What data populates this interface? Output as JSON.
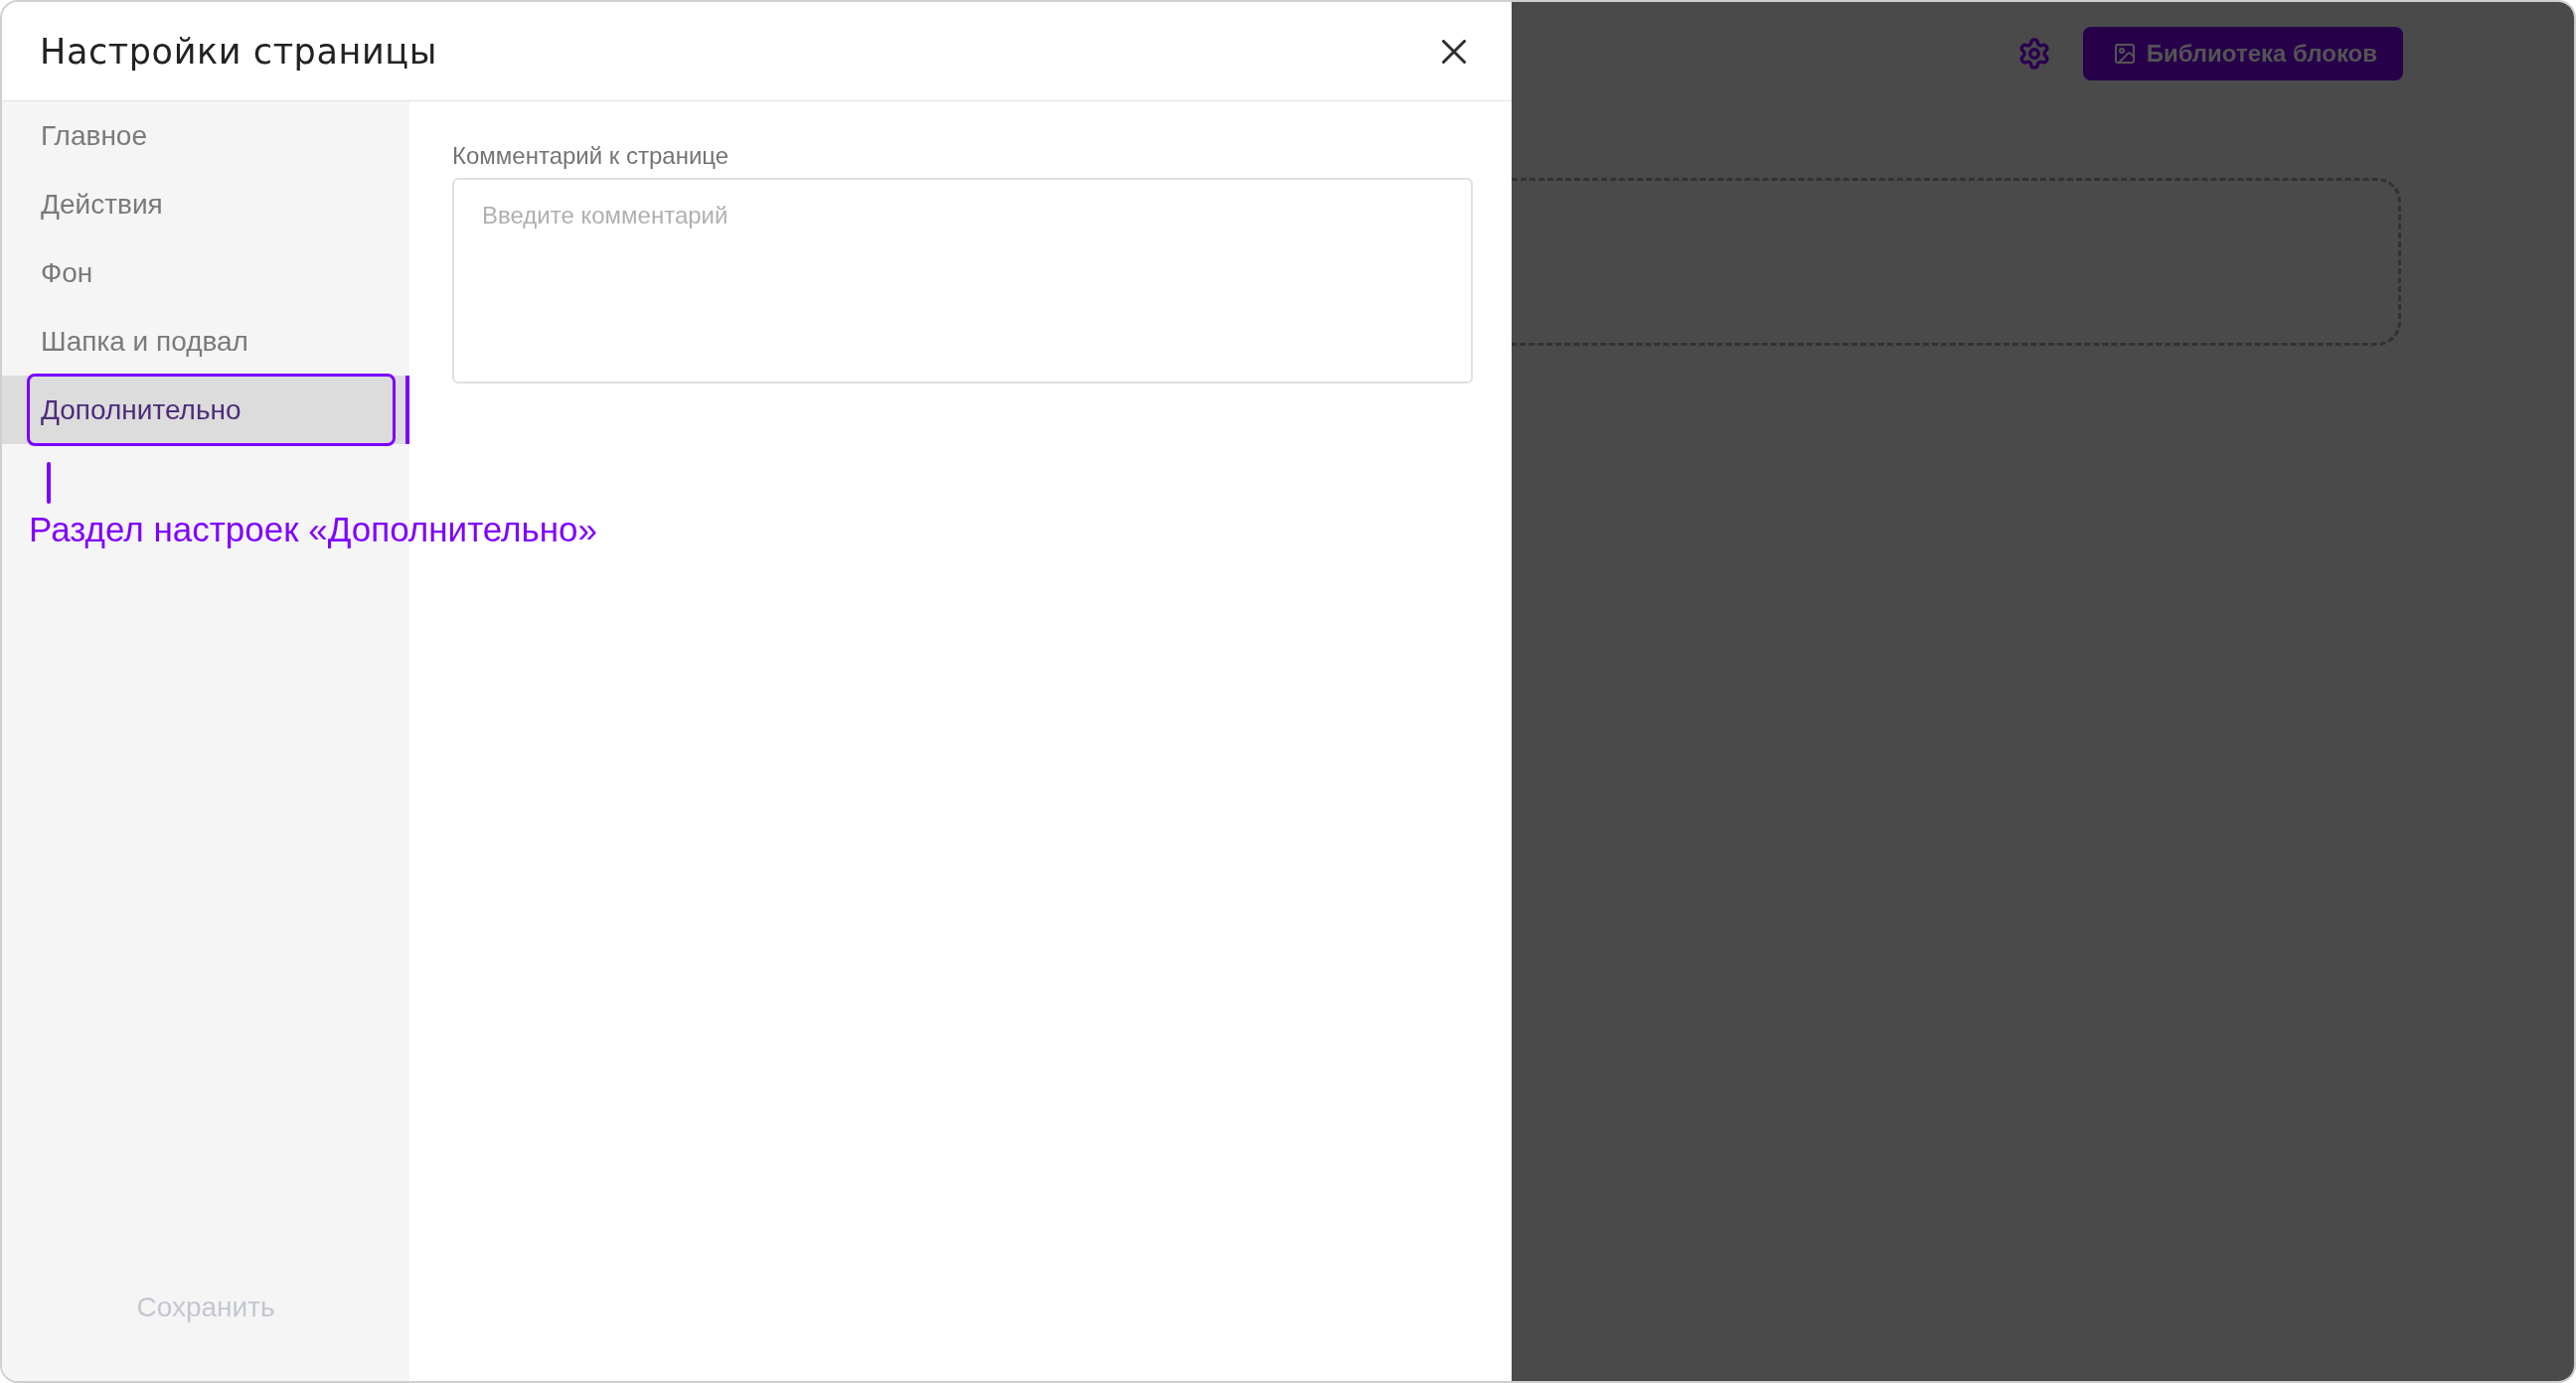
{
  "dialog": {
    "title": "Настройки страницы"
  },
  "sidebar": {
    "items": [
      {
        "label": "Главное",
        "selected": false,
        "highlighted": false
      },
      {
        "label": "Действия",
        "selected": false,
        "highlighted": false
      },
      {
        "label": "Фон",
        "selected": false,
        "highlighted": false
      },
      {
        "label": "Шапка и подвал",
        "selected": false,
        "highlighted": false
      },
      {
        "label": "Дополнительно",
        "selected": true,
        "highlighted": true
      }
    ],
    "save_button": {
      "label": "Сохранить",
      "disabled": true
    }
  },
  "content": {
    "comment": {
      "label": "Комментарий к странице",
      "placeholder": "Введите комментарий"
    }
  },
  "page_behind": {
    "library_button": {
      "label": "Библиотека блоков"
    }
  },
  "annotation": {
    "text": "Раздел настроек «Дополнительно»"
  }
}
